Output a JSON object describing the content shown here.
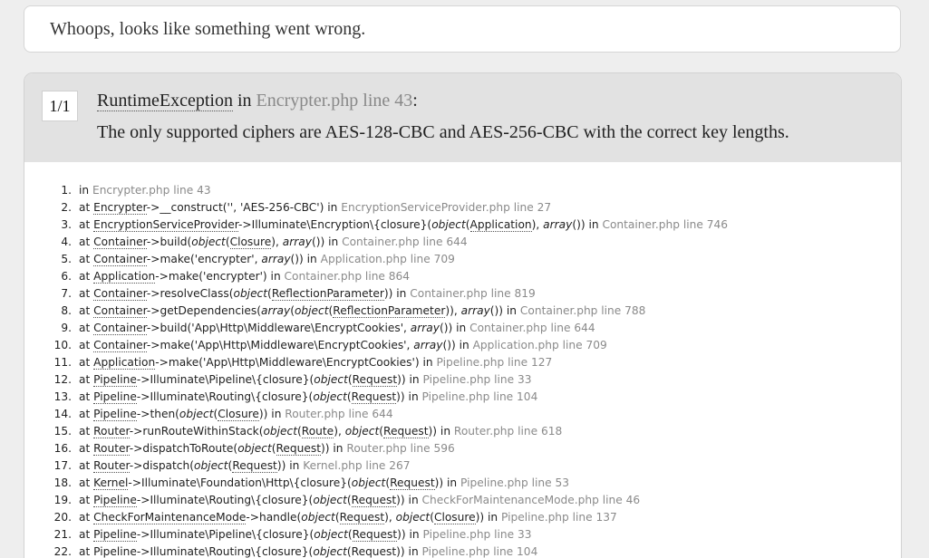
{
  "top": {
    "message": "Whoops, looks like something went wrong."
  },
  "exception": {
    "counter": "1/1",
    "class": "RuntimeException",
    "in_word": "in",
    "location": "Encrypter.php line 43",
    "colon": ":",
    "message": "The only supported ciphers are AES-128-CBC and AES-256-CBC with the correct key lengths."
  },
  "trace": [
    {
      "num": "1.",
      "parts": [
        {
          "t": "txt",
          "v": "in "
        },
        {
          "t": "file",
          "v": "Encrypter.php line 43"
        }
      ]
    },
    {
      "num": "2.",
      "parts": [
        {
          "t": "txt",
          "v": "at "
        },
        {
          "t": "cls",
          "v": "Encrypter"
        },
        {
          "t": "txt",
          "v": "->__construct('', 'AES-256-CBC') in "
        },
        {
          "t": "file",
          "v": "EncryptionServiceProvider.php line 27"
        }
      ]
    },
    {
      "num": "3.",
      "parts": [
        {
          "t": "txt",
          "v": "at "
        },
        {
          "t": "cls",
          "v": "EncryptionServiceProvider"
        },
        {
          "t": "txt",
          "v": "->Illuminate\\Encryption\\{closure}("
        },
        {
          "t": "em",
          "v": "object"
        },
        {
          "t": "txt",
          "v": "("
        },
        {
          "t": "cls",
          "v": "Application"
        },
        {
          "t": "txt",
          "v": "), "
        },
        {
          "t": "em",
          "v": "array"
        },
        {
          "t": "txt",
          "v": "()) in "
        },
        {
          "t": "file",
          "v": "Container.php line 746"
        }
      ]
    },
    {
      "num": "4.",
      "parts": [
        {
          "t": "txt",
          "v": "at "
        },
        {
          "t": "cls",
          "v": "Container"
        },
        {
          "t": "txt",
          "v": "->build("
        },
        {
          "t": "em",
          "v": "object"
        },
        {
          "t": "txt",
          "v": "("
        },
        {
          "t": "cls",
          "v": "Closure"
        },
        {
          "t": "txt",
          "v": "), "
        },
        {
          "t": "em",
          "v": "array"
        },
        {
          "t": "txt",
          "v": "()) in "
        },
        {
          "t": "file",
          "v": "Container.php line 644"
        }
      ]
    },
    {
      "num": "5.",
      "parts": [
        {
          "t": "txt",
          "v": "at "
        },
        {
          "t": "cls",
          "v": "Container"
        },
        {
          "t": "txt",
          "v": "->make('encrypter', "
        },
        {
          "t": "em",
          "v": "array"
        },
        {
          "t": "txt",
          "v": "()) in "
        },
        {
          "t": "file",
          "v": "Application.php line 709"
        }
      ]
    },
    {
      "num": "6.",
      "parts": [
        {
          "t": "txt",
          "v": "at "
        },
        {
          "t": "cls",
          "v": "Application"
        },
        {
          "t": "txt",
          "v": "->make('encrypter') in "
        },
        {
          "t": "file",
          "v": "Container.php line 864"
        }
      ]
    },
    {
      "num": "7.",
      "parts": [
        {
          "t": "txt",
          "v": "at "
        },
        {
          "t": "cls",
          "v": "Container"
        },
        {
          "t": "txt",
          "v": "->resolveClass("
        },
        {
          "t": "em",
          "v": "object"
        },
        {
          "t": "txt",
          "v": "("
        },
        {
          "t": "cls",
          "v": "ReflectionParameter"
        },
        {
          "t": "txt",
          "v": ")) in "
        },
        {
          "t": "file",
          "v": "Container.php line 819"
        }
      ]
    },
    {
      "num": "8.",
      "parts": [
        {
          "t": "txt",
          "v": "at "
        },
        {
          "t": "cls",
          "v": "Container"
        },
        {
          "t": "txt",
          "v": "->getDependencies("
        },
        {
          "t": "em",
          "v": "array"
        },
        {
          "t": "txt",
          "v": "("
        },
        {
          "t": "em",
          "v": "object"
        },
        {
          "t": "txt",
          "v": "("
        },
        {
          "t": "cls",
          "v": "ReflectionParameter"
        },
        {
          "t": "txt",
          "v": ")), "
        },
        {
          "t": "em",
          "v": "array"
        },
        {
          "t": "txt",
          "v": "()) in "
        },
        {
          "t": "file",
          "v": "Container.php line 788"
        }
      ]
    },
    {
      "num": "9.",
      "parts": [
        {
          "t": "txt",
          "v": "at "
        },
        {
          "t": "cls",
          "v": "Container"
        },
        {
          "t": "txt",
          "v": "->build('App\\Http\\Middleware\\EncryptCookies', "
        },
        {
          "t": "em",
          "v": "array"
        },
        {
          "t": "txt",
          "v": "()) in "
        },
        {
          "t": "file",
          "v": "Container.php line 644"
        }
      ]
    },
    {
      "num": "10.",
      "parts": [
        {
          "t": "txt",
          "v": "at "
        },
        {
          "t": "cls",
          "v": "Container"
        },
        {
          "t": "txt",
          "v": "->make('App\\Http\\Middleware\\EncryptCookies', "
        },
        {
          "t": "em",
          "v": "array"
        },
        {
          "t": "txt",
          "v": "()) in "
        },
        {
          "t": "file",
          "v": "Application.php line 709"
        }
      ]
    },
    {
      "num": "11.",
      "parts": [
        {
          "t": "txt",
          "v": "at "
        },
        {
          "t": "cls",
          "v": "Application"
        },
        {
          "t": "txt",
          "v": "->make('App\\Http\\Middleware\\EncryptCookies') in "
        },
        {
          "t": "file",
          "v": "Pipeline.php line 127"
        }
      ]
    },
    {
      "num": "12.",
      "parts": [
        {
          "t": "txt",
          "v": "at "
        },
        {
          "t": "cls",
          "v": "Pipeline"
        },
        {
          "t": "txt",
          "v": "->Illuminate\\Pipeline\\{closure}("
        },
        {
          "t": "em",
          "v": "object"
        },
        {
          "t": "txt",
          "v": "("
        },
        {
          "t": "cls",
          "v": "Request"
        },
        {
          "t": "txt",
          "v": ")) in "
        },
        {
          "t": "file",
          "v": "Pipeline.php line 33"
        }
      ]
    },
    {
      "num": "13.",
      "parts": [
        {
          "t": "txt",
          "v": "at "
        },
        {
          "t": "cls",
          "v": "Pipeline"
        },
        {
          "t": "txt",
          "v": "->Illuminate\\Routing\\{closure}("
        },
        {
          "t": "em",
          "v": "object"
        },
        {
          "t": "txt",
          "v": "("
        },
        {
          "t": "cls",
          "v": "Request"
        },
        {
          "t": "txt",
          "v": ")) in "
        },
        {
          "t": "file",
          "v": "Pipeline.php line 104"
        }
      ]
    },
    {
      "num": "14.",
      "parts": [
        {
          "t": "txt",
          "v": "at "
        },
        {
          "t": "cls",
          "v": "Pipeline"
        },
        {
          "t": "txt",
          "v": "->then("
        },
        {
          "t": "em",
          "v": "object"
        },
        {
          "t": "txt",
          "v": "("
        },
        {
          "t": "cls",
          "v": "Closure"
        },
        {
          "t": "txt",
          "v": ")) in "
        },
        {
          "t": "file",
          "v": "Router.php line 644"
        }
      ]
    },
    {
      "num": "15.",
      "parts": [
        {
          "t": "txt",
          "v": "at "
        },
        {
          "t": "cls",
          "v": "Router"
        },
        {
          "t": "txt",
          "v": "->runRouteWithinStack("
        },
        {
          "t": "em",
          "v": "object"
        },
        {
          "t": "txt",
          "v": "("
        },
        {
          "t": "cls",
          "v": "Route"
        },
        {
          "t": "txt",
          "v": "), "
        },
        {
          "t": "em",
          "v": "object"
        },
        {
          "t": "txt",
          "v": "("
        },
        {
          "t": "cls",
          "v": "Request"
        },
        {
          "t": "txt",
          "v": ")) in "
        },
        {
          "t": "file",
          "v": "Router.php line 618"
        }
      ]
    },
    {
      "num": "16.",
      "parts": [
        {
          "t": "txt",
          "v": "at "
        },
        {
          "t": "cls",
          "v": "Router"
        },
        {
          "t": "txt",
          "v": "->dispatchToRoute("
        },
        {
          "t": "em",
          "v": "object"
        },
        {
          "t": "txt",
          "v": "("
        },
        {
          "t": "cls",
          "v": "Request"
        },
        {
          "t": "txt",
          "v": ")) in "
        },
        {
          "t": "file",
          "v": "Router.php line 596"
        }
      ]
    },
    {
      "num": "17.",
      "parts": [
        {
          "t": "txt",
          "v": "at "
        },
        {
          "t": "cls",
          "v": "Router"
        },
        {
          "t": "txt",
          "v": "->dispatch("
        },
        {
          "t": "em",
          "v": "object"
        },
        {
          "t": "txt",
          "v": "("
        },
        {
          "t": "cls",
          "v": "Request"
        },
        {
          "t": "txt",
          "v": ")) in "
        },
        {
          "t": "file",
          "v": "Kernel.php line 267"
        }
      ]
    },
    {
      "num": "18.",
      "parts": [
        {
          "t": "txt",
          "v": "at "
        },
        {
          "t": "cls",
          "v": "Kernel"
        },
        {
          "t": "txt",
          "v": "->Illuminate\\Foundation\\Http\\{closure}("
        },
        {
          "t": "em",
          "v": "object"
        },
        {
          "t": "txt",
          "v": "("
        },
        {
          "t": "cls",
          "v": "Request"
        },
        {
          "t": "txt",
          "v": ")) in "
        },
        {
          "t": "file",
          "v": "Pipeline.php line 53"
        }
      ]
    },
    {
      "num": "19.",
      "parts": [
        {
          "t": "txt",
          "v": "at "
        },
        {
          "t": "cls",
          "v": "Pipeline"
        },
        {
          "t": "txt",
          "v": "->Illuminate\\Routing\\{closure}("
        },
        {
          "t": "em",
          "v": "object"
        },
        {
          "t": "txt",
          "v": "("
        },
        {
          "t": "cls",
          "v": "Request"
        },
        {
          "t": "txt",
          "v": ")) in "
        },
        {
          "t": "file",
          "v": "CheckForMaintenanceMode.php line 46"
        }
      ]
    },
    {
      "num": "20.",
      "parts": [
        {
          "t": "txt",
          "v": "at "
        },
        {
          "t": "cls",
          "v": "CheckForMaintenanceMode"
        },
        {
          "t": "txt",
          "v": "->handle("
        },
        {
          "t": "em",
          "v": "object"
        },
        {
          "t": "txt",
          "v": "("
        },
        {
          "t": "cls",
          "v": "Request"
        },
        {
          "t": "txt",
          "v": "), "
        },
        {
          "t": "em",
          "v": "object"
        },
        {
          "t": "txt",
          "v": "("
        },
        {
          "t": "cls",
          "v": "Closure"
        },
        {
          "t": "txt",
          "v": ")) in "
        },
        {
          "t": "file",
          "v": "Pipeline.php line 137"
        }
      ]
    },
    {
      "num": "21.",
      "parts": [
        {
          "t": "txt",
          "v": "at "
        },
        {
          "t": "cls",
          "v": "Pipeline"
        },
        {
          "t": "txt",
          "v": "->Illuminate\\Pipeline\\{closure}("
        },
        {
          "t": "em",
          "v": "object"
        },
        {
          "t": "txt",
          "v": "("
        },
        {
          "t": "cls",
          "v": "Request"
        },
        {
          "t": "txt",
          "v": ")) in "
        },
        {
          "t": "file",
          "v": "Pipeline.php line 33"
        }
      ]
    },
    {
      "num": "22.",
      "parts": [
        {
          "t": "txt",
          "v": "at "
        },
        {
          "t": "cls",
          "v": "Pipeline"
        },
        {
          "t": "txt",
          "v": "->Illuminate\\Routing\\{closure}("
        },
        {
          "t": "em",
          "v": "object"
        },
        {
          "t": "txt",
          "v": "("
        },
        {
          "t": "cls",
          "v": "Request"
        },
        {
          "t": "txt",
          "v": ")) in "
        },
        {
          "t": "file",
          "v": "Pipeline.php line 104"
        }
      ]
    }
  ]
}
